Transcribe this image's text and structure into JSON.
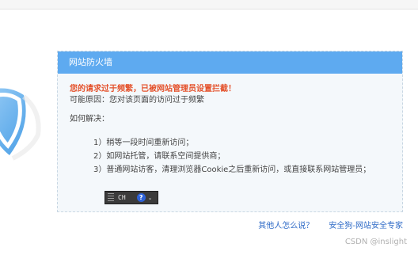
{
  "panel": {
    "title": "网站防火墙",
    "warning": "您的请求过于频繁，已被网站管理员设置拦截！",
    "reason": "可能原因：您对该页面的访问过于频繁",
    "how_label": "如何解决：",
    "steps": [
      "1）稍等一段时间重新访问；",
      "2）如网站托管，请联系空间提供商；",
      "3）普通网站访客，清理浏览器Cookie之后重新访问，或直接联系网站管理员；"
    ]
  },
  "ime_toolbar": {
    "mode": "CH",
    "help": "?",
    "arrow": "⌄"
  },
  "footer": {
    "link_others": "其他人怎么说？",
    "link_brand": "安全狗-网站安全专家"
  },
  "watermark": "CSDN @inslight",
  "colors": {
    "header": "#5eaaf0",
    "warning": "#e4512b",
    "link": "#2f6bc7"
  }
}
